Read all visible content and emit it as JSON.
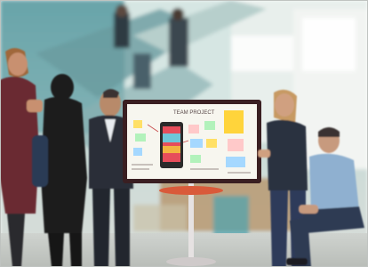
{
  "photo": {
    "subject": "office-meeting-photo",
    "board": {
      "title": "TEAM PROJECT",
      "sticky_colors": [
        "#ffe066",
        "#ffd43b",
        "#b2f2bb",
        "#a5d8ff",
        "#ffc9c9"
      ]
    }
  }
}
